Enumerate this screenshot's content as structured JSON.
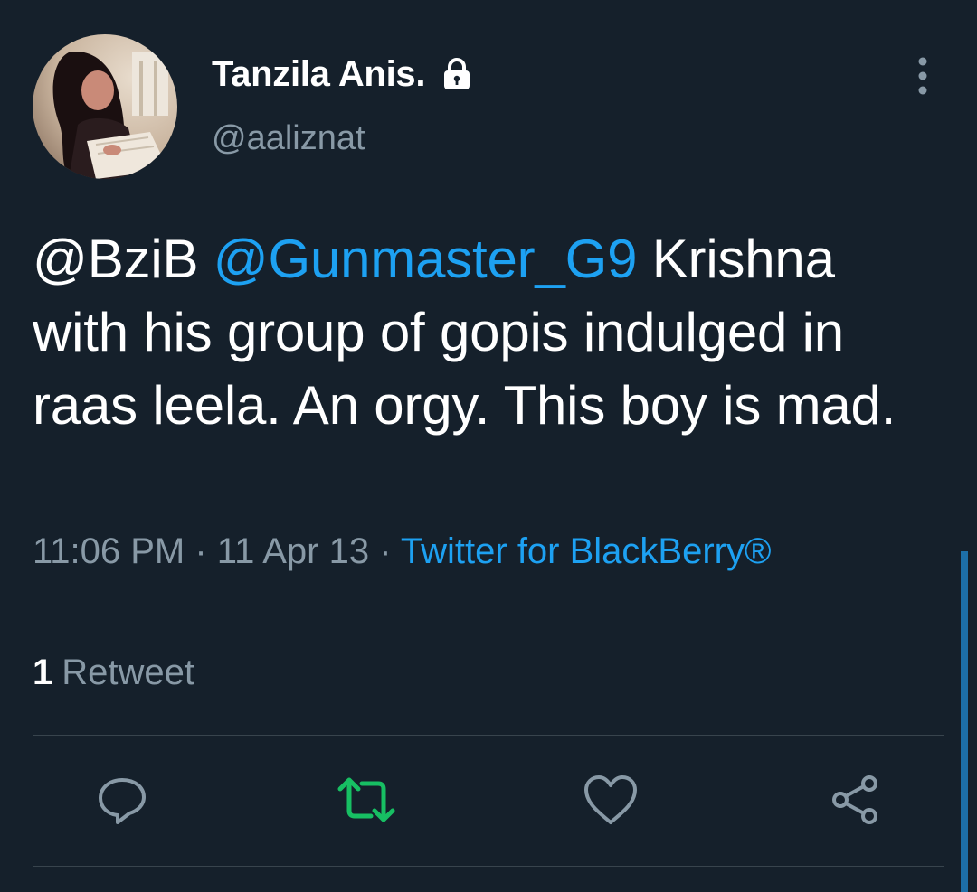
{
  "user": {
    "display_name": "Tanzila Anis.",
    "handle": "@aaliznat",
    "protected_icon": "lock-icon"
  },
  "tweet": {
    "mention1": "@BziB",
    "mention2": "@Gunmaster_G9",
    "text": " Krishna with his group of gopis indulged in raas leela. An orgy. This boy is mad."
  },
  "meta": {
    "time": "11:06 PM",
    "sep1": " · ",
    "date": "11 Apr 13",
    "sep2": " · ",
    "source": "Twitter for BlackBerry®"
  },
  "stats": {
    "retweet_count": "1",
    "retweet_label": "Retweet"
  },
  "actions": {
    "reply_icon": "reply-icon",
    "retweet_icon": "retweet-icon",
    "like_icon": "heart-icon",
    "share_icon": "share-icon"
  },
  "colors": {
    "background": "#15202b",
    "link": "#1da1f2",
    "secondary_text": "#8899a6",
    "retweet_active": "#17bf63",
    "divider": "#38444d"
  }
}
